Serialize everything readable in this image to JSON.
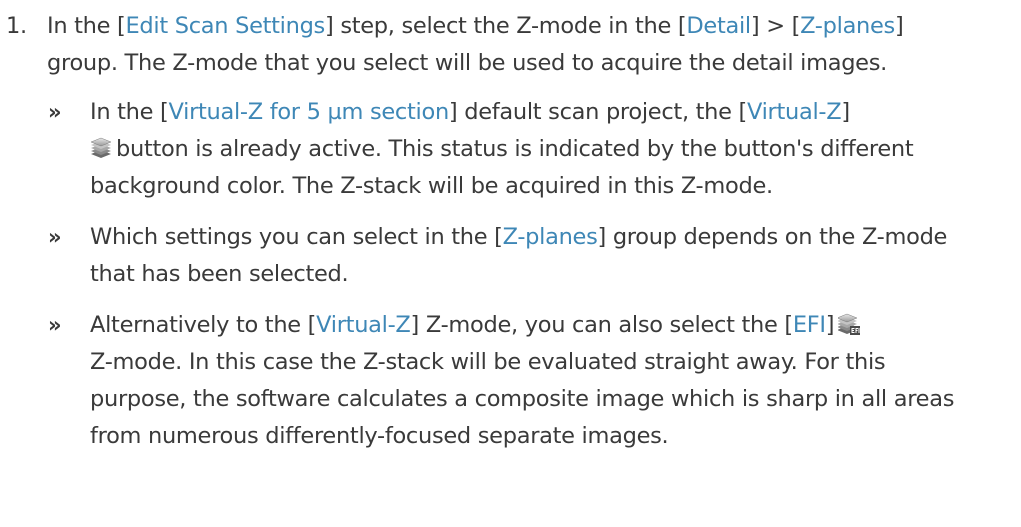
{
  "step": {
    "number": "1.",
    "text_1": "In the [",
    "edit_scan_settings": "Edit Scan Settings",
    "text_2": "] step, select the Z-mode in the [",
    "detail": "Detail",
    "text_3": "] > [",
    "z_planes": "Z-planes",
    "text_4": "] group. The Z-mode that you select will be used to acquire the detail images."
  },
  "results": [
    {
      "arrow": "»",
      "text_1": "In the [",
      "link_1": "Virtual-Z for 5 µm section",
      "text_2": "] default scan project, the [",
      "link_2": "Virtual-Z",
      "text_3": "]",
      "icon": "layers-icon",
      "text_4": "button is already active. This status is indicated by the button's different background color. The Z-stack will be acquired in this Z-mode."
    },
    {
      "arrow": "»",
      "text_1": "Which settings you can select in the [",
      "link_1": "Z-planes",
      "text_2": "] group depends on the Z-mode that has been selected."
    },
    {
      "arrow": "»",
      "text_1": "Alternatively to the [",
      "link_1": "Virtual-Z",
      "text_2": "] Z-mode, you can also select the [",
      "link_2": "EFI",
      "text_3": "]",
      "icon": "efi-layers-icon",
      "text_4": "Z-mode. In this case the Z-stack will be evaluated straight away. For this purpose, the software calculates a composite image which is sharp in all areas from numerous differently-focused separate images."
    }
  ]
}
